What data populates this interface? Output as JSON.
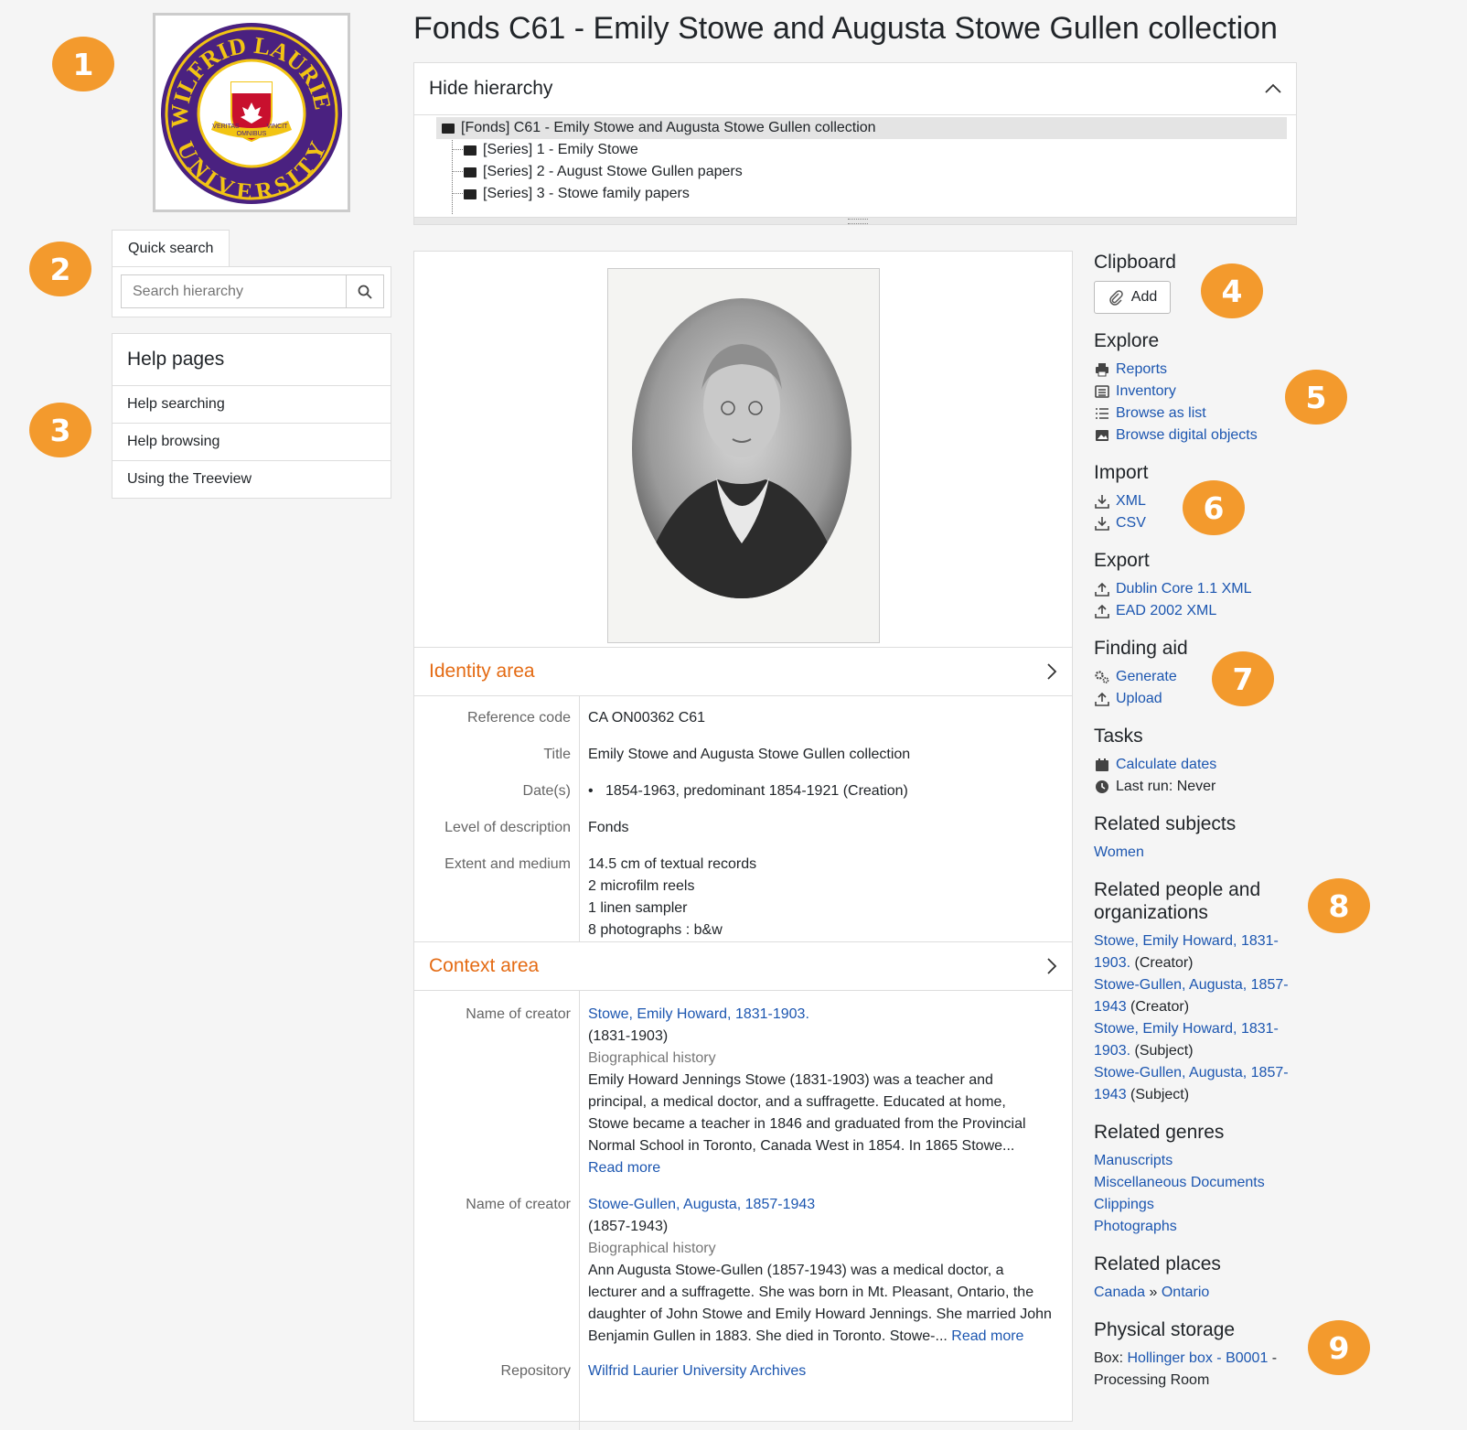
{
  "badges": [
    "1",
    "2",
    "3",
    "4",
    "5",
    "6",
    "7",
    "8",
    "9"
  ],
  "logo": {
    "top_text": "WILFRID LAURIER",
    "bottom_text": "UNIVERSITY",
    "motto": [
      "VERITAS",
      "OMNIBUS",
      "VINCIT"
    ]
  },
  "page_title": "Fonds C61 - Emily Stowe and Augusta Stowe Gullen collection",
  "hierarchy": {
    "toggle_label": "Hide hierarchy",
    "root": "[Fonds] C61 - Emily Stowe and Augusta Stowe Gullen collection",
    "children": [
      "[Series] 1 - Emily Stowe",
      "[Series] 2 - August Stowe Gullen papers",
      "[Series] 3 - Stowe family papers"
    ]
  },
  "quick_search": {
    "tab_label": "Quick search",
    "placeholder": "Search hierarchy"
  },
  "help": {
    "title": "Help pages",
    "items": [
      "Help searching",
      "Help browsing",
      "Using the Treeview"
    ]
  },
  "identity": {
    "title": "Identity area",
    "rows": [
      {
        "label": "Reference code",
        "value": "CA ON00362 C61"
      },
      {
        "label": "Title",
        "value": "Emily Stowe and Augusta Stowe Gullen collection"
      },
      {
        "label": "Date(s)",
        "value": "1854-1963, predominant 1854-1921 (Creation)"
      },
      {
        "label": "Level of description",
        "value": "Fonds"
      },
      {
        "label": "Extent and medium",
        "value": [
          "14.5 cm of textual records",
          "2 microfilm reels",
          "1 linen sampler",
          "8 photographs : b&w"
        ]
      }
    ]
  },
  "context": {
    "title": "Context area",
    "creators": [
      {
        "label": "Name of creator",
        "name": "Stowe, Emily Howard, 1831-1903.",
        "dates": "(1831-1903)",
        "bio_label": "Biographical history",
        "bio": [
          "Emily Howard Jennings Stowe (1831-1903) was a teacher and",
          "principal, a medical doctor, and a suffragette. Educated at home,",
          "Stowe became a teacher in 1846 and graduated from the Provincial",
          "Normal School in Toronto, Canada West in 1854. In 1865 Stowe..."
        ],
        "read_more": "Read more"
      },
      {
        "label": "Name of creator",
        "name": "Stowe-Gullen, Augusta, 1857-1943",
        "dates": "(1857-1943)",
        "bio_label": "Biographical history",
        "bio": [
          "Ann Augusta Stowe-Gullen (1857-1943) was a medical doctor, a",
          "lecturer and a suffragette. She was born in Mt. Pleasant, Ontario, the",
          "daughter of John Stowe and Emily Howard Jennings. She married John",
          "Benjamin Gullen in 1883. She died in Toronto. Stowe-..."
        ],
        "read_more": "Read more"
      }
    ],
    "repository_label": "Repository",
    "repository": "Wilfrid Laurier University Archives"
  },
  "sidebar": {
    "clipboard": {
      "title": "Clipboard",
      "add_label": "Add"
    },
    "explore": {
      "title": "Explore",
      "links": [
        "Reports",
        "Inventory",
        "Browse as list",
        "Browse digital objects"
      ]
    },
    "import": {
      "title": "Import",
      "links": [
        "XML",
        "CSV"
      ]
    },
    "export": {
      "title": "Export",
      "links": [
        "Dublin Core 1.1 XML",
        "EAD 2002 XML"
      ]
    },
    "finding_aid": {
      "title": "Finding aid",
      "links": [
        "Generate",
        "Upload"
      ]
    },
    "tasks": {
      "title": "Tasks",
      "link": "Calculate dates",
      "last_run": "Last run: Never"
    },
    "related_subjects": {
      "title": "Related subjects",
      "links": [
        "Women"
      ]
    },
    "related_people": {
      "title_lines": [
        "Related people and",
        "organizations"
      ],
      "entries": [
        {
          "name_lines": [
            "Stowe, Emily Howard, 1831-",
            "1903."
          ],
          "role": "(Creator)"
        },
        {
          "name_lines": [
            "Stowe-Gullen, Augusta, 1857-",
            "1943"
          ],
          "role": "(Creator)"
        },
        {
          "name_lines": [
            "Stowe, Emily Howard, 1831-",
            "1903."
          ],
          "role": "(Subject)"
        },
        {
          "name_lines": [
            "Stowe-Gullen, Augusta, 1857-",
            "1943"
          ],
          "role": "(Subject)"
        }
      ]
    },
    "related_genres": {
      "title": "Related genres",
      "links": [
        "Manuscripts",
        "Miscellaneous Documents",
        "Clippings",
        "Photographs"
      ]
    },
    "related_places": {
      "title": "Related places",
      "links": [
        "Canada",
        "Ontario"
      ],
      "separator": "»"
    },
    "physical_storage": {
      "title": "Physical storage",
      "prefix": "Box:",
      "link": "Hollinger box - B0001",
      "suffix": "-",
      "location": "Processing Room"
    }
  }
}
